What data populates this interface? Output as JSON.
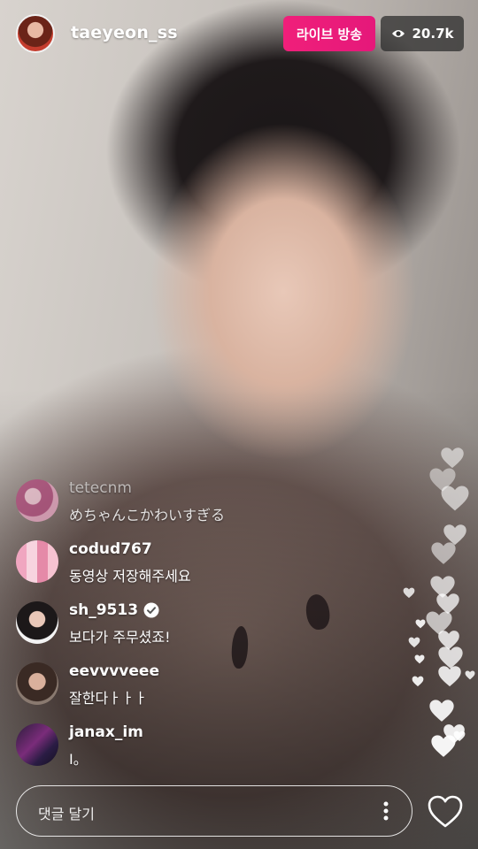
{
  "header": {
    "username": "taeyeon_ss",
    "live_label": "라이브 방송",
    "viewer_count": "20.7k"
  },
  "comments": [
    {
      "username": "tetecnm",
      "text": "めちゃんこかわいすぎる",
      "verified": false,
      "dim": true
    },
    {
      "username": "codud767",
      "text": "동영상 저장해주세요",
      "verified": false,
      "dim": false
    },
    {
      "username": "sh_9513",
      "text": "보다가 주무셨죠!",
      "verified": true,
      "dim": false
    },
    {
      "username": "eevvvveee",
      "text": "잘한다ㅏㅏㅏ",
      "verified": false,
      "dim": false
    },
    {
      "username": "janax_im",
      "text": "I。",
      "verified": false,
      "dim": false
    }
  ],
  "composer": {
    "placeholder": "댓글 달기"
  },
  "colors": {
    "live_badge": "#e5187a",
    "viewer_badge_bg": "#282828"
  },
  "icons": [
    "eye-icon",
    "verified-badge-icon",
    "more-options-icon",
    "heart-icon",
    "floating-heart-icon"
  ]
}
